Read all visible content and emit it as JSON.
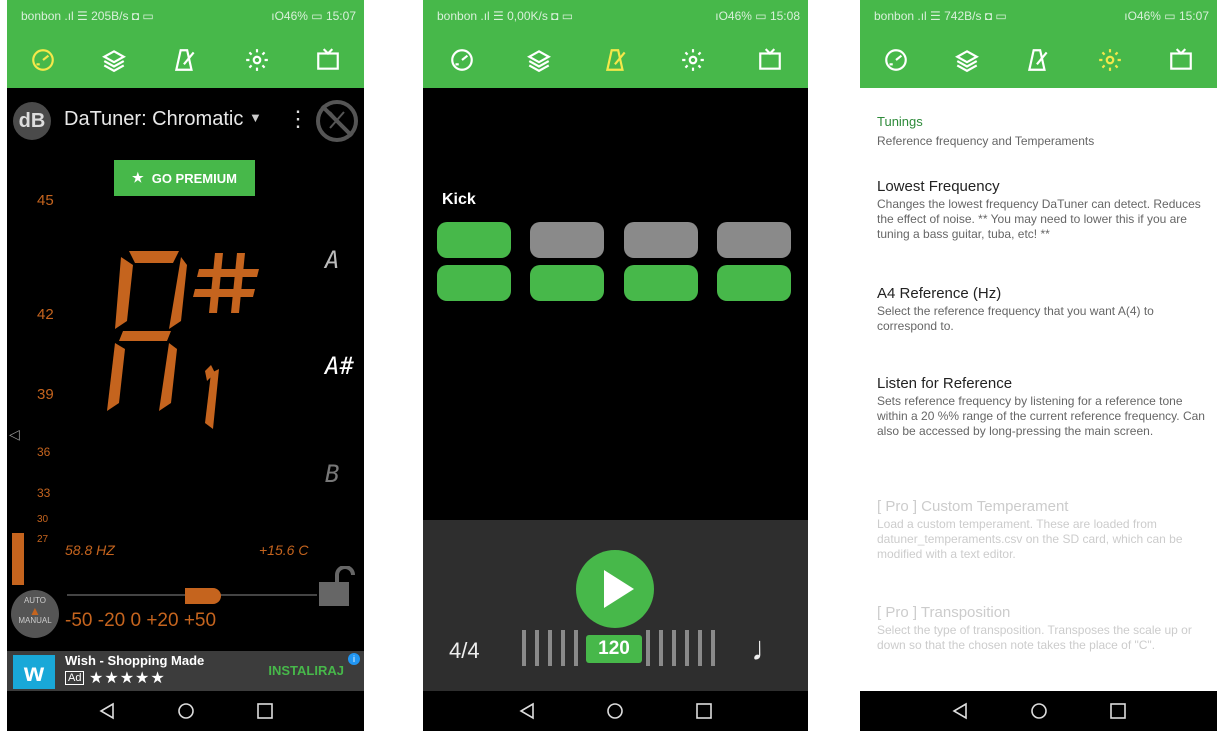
{
  "colors": {
    "accent": "#47b84a",
    "tuner_orange": "#c5641e"
  },
  "screen1": {
    "status_left": "bonbon .ıl ☰ 205B/s ◘ ▭",
    "status_right": "ıО46% ▭ 15:07",
    "tabs": [
      "tuner-icon",
      "layers-icon",
      "metronome-icon",
      "gear-icon",
      "ad-free-icon"
    ],
    "db_label": "dB",
    "title": "DaTuner: Chromatic",
    "premium": "GO PREMIUM",
    "scale": [
      "45",
      "42",
      "39",
      "36",
      "33",
      "30",
      "27"
    ],
    "notes": [
      "A",
      "A#",
      "B"
    ],
    "freq": "58.8 HZ",
    "cents": "+15.6 C",
    "cent_scale": "-50  -20  0  +20  +50",
    "auto_label": "AUTO",
    "manual_label": "MANUAL",
    "ad": {
      "title": "Wish - Shopping Made",
      "ad_tag": "Ad",
      "stars": "★★★★★",
      "cta": "INSTALIRAJ",
      "logo": "w"
    }
  },
  "screen2": {
    "status_left": "bonbon .ıl ☰ 0,00K/s ◘ ▭",
    "status_right": "ıО46% ▭ 15:08",
    "kick": "Kick",
    "time_signature": "4/4",
    "tempo": "120",
    "note_value": "♩"
  },
  "screen3": {
    "status_left": "bonbon .ıl ☰ 742B/s ◘ ▭",
    "status_right": "ıО46% ▭ 15:07",
    "category": "Tunings",
    "category_desc": "Reference frequency and Temperaments",
    "items": [
      {
        "title": "Lowest Frequency",
        "desc": "Changes the lowest frequency DaTuner can detect. Reduces the effect of noise. ** You may need to lower this if you are tuning a bass guitar, tuba, etc! **"
      },
      {
        "title": "A4 Reference (Hz)",
        "desc": "Select the reference frequency that you want A(4) to correspond to."
      },
      {
        "title": "Listen for Reference",
        "desc": "Sets reference frequency by listening for a reference tone within a 20 %% range of the current reference frequency. Can also be accessed by long-pressing the main screen."
      },
      {
        "title": "[ Pro ] Custom Temperament",
        "desc": "Load a custom temperament. These are loaded from datuner_temperaments.csv on the SD card, which can be modified with a text editor."
      },
      {
        "title": "[ Pro ] Transposition",
        "desc": "Select the type of transposition. Transposes the scale up or down so that the chosen note takes the place of \"C\"."
      }
    ]
  }
}
